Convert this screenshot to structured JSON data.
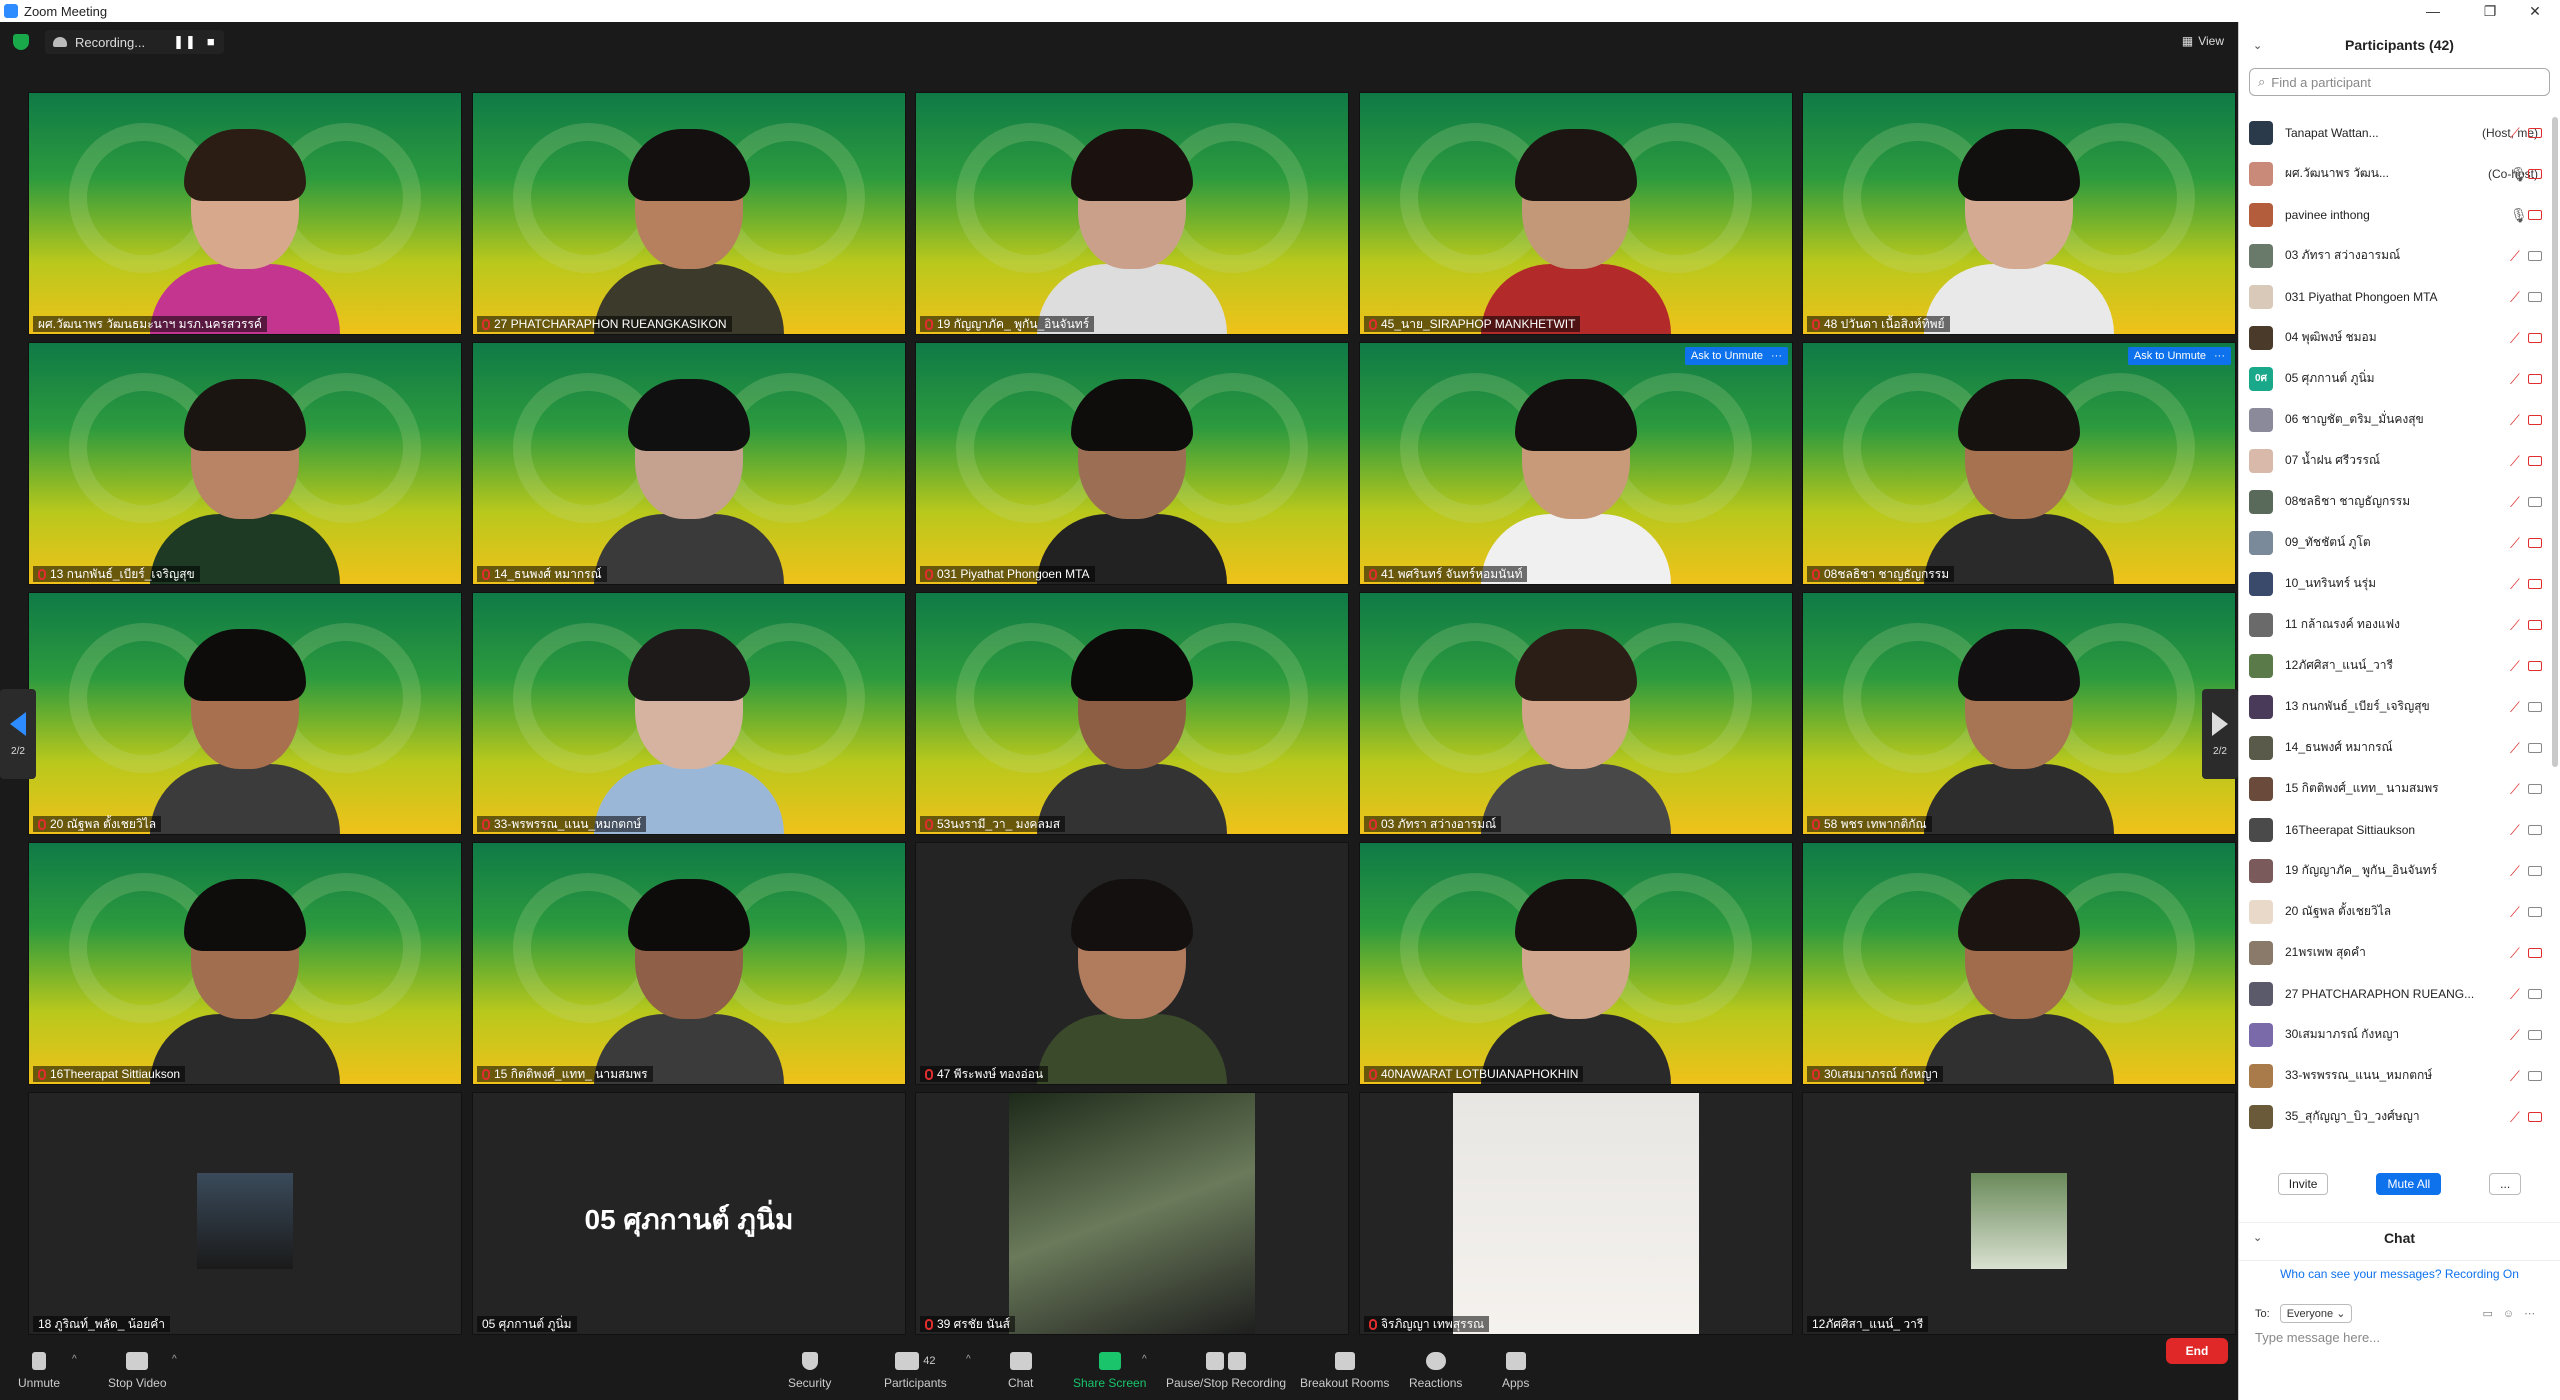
{
  "window": {
    "title": "Zoom Meeting"
  },
  "recording": {
    "label": "Recording...",
    "pause_glyph": "❚❚",
    "stop_glyph": "■"
  },
  "view_button": {
    "label": "View"
  },
  "tiles": [
    {
      "name": "ผศ.วัฒนาพร วัฒนธมะนาฯ มรภ.นครสวรรค์",
      "bg": "green",
      "muted": false,
      "skin": "#d7a88b",
      "hair": "#2b1c14",
      "shirt": "#c4358f"
    },
    {
      "name": "27 PHATCHARAPHON RUEANGKASIKON",
      "bg": "green",
      "muted": true,
      "skin": "#b6805f",
      "hair": "#141010",
      "shirt": "#3c3a2a"
    },
    {
      "name": "19 กัญญาภัค_ พูกัน_อินจันทร์",
      "bg": "green",
      "muted": true,
      "skin": "#caa08b",
      "hair": "#1b1210",
      "shirt": "#ddd"
    },
    {
      "name": "45_นาย_SIRAPHOP MANKHETWIT",
      "bg": "green",
      "muted": true,
      "skin": "#c29878",
      "hair": "#1c1512",
      "shirt": "#b22a2a"
    },
    {
      "name": "48 ปวันดา เนื้อสิงห์ทิพย์",
      "bg": "green",
      "muted": true,
      "skin": "#d4aa92",
      "hair": "#12100e",
      "shirt": "#e9e9e9"
    },
    {
      "name": "13 กนกพันธ์_เบียร์_เจริญสุข",
      "bg": "green",
      "muted": true,
      "skin": "#b98465",
      "hair": "#1b1512",
      "shirt": "#1e3a24"
    },
    {
      "name": "14_ธนพงศ์ หมากรณ์",
      "bg": "green",
      "muted": true,
      "skin": "#c5a18f",
      "hair": "#101010",
      "shirt": "#3a3a3a"
    },
    {
      "name": "031 Piyathat Phongoen MTA",
      "bg": "green",
      "muted": true,
      "skin": "#9c6f55",
      "hair": "#0f0d0c",
      "shirt": "#222"
    },
    {
      "name": "41 พศรินทร์ จันทร์หอมนันท์",
      "bg": "green",
      "muted": true,
      "skin": "#c89a7a",
      "hair": "#141010",
      "shirt": "#f0f0f0",
      "ask": true
    },
    {
      "name": "08ชลธิชา ชาญธัญกรรม",
      "bg": "green",
      "muted": true,
      "skin": "#a7724f",
      "hair": "#161210",
      "shirt": "#2a2a2a",
      "ask": true
    },
    {
      "name": "20 ณัฐพล ตั้งเชยวิไล",
      "bg": "green",
      "muted": true,
      "skin": "#a8704f",
      "hair": "#0e0c0b",
      "shirt": "#3b3b3b"
    },
    {
      "name": "33-พรพรรณ_แนน_หมกตกษ์",
      "bg": "green",
      "muted": true,
      "skin": "#d6b3a1",
      "hair": "#1d1a19",
      "shirt": "#9bb7d8"
    },
    {
      "name": "53นงรามี_วา_ มงคลมส",
      "bg": "green",
      "muted": true,
      "skin": "#8e5e44",
      "hair": "#0d0b0a",
      "shirt": "#333"
    },
    {
      "name": "03 ภัทรา สว่างอารมณ์",
      "bg": "green",
      "muted": true,
      "skin": "#d2a58a",
      "hair": "#2b1e17",
      "shirt": "#484848"
    },
    {
      "name": "58 พชร เทพากติกัณ",
      "bg": "green",
      "muted": true,
      "skin": "#a77553",
      "hair": "#121010",
      "shirt": "#2d2d2d"
    },
    {
      "name": "16Theerapat Sittiaukson",
      "bg": "green",
      "muted": true,
      "skin": "#a26e50",
      "hair": "#0f0d0c",
      "shirt": "#2b2b2b"
    },
    {
      "name": "15 กิตติพงศ์_แทท_ นามสมพร",
      "bg": "green",
      "muted": true,
      "skin": "#8f6047",
      "hair": "#0e0c0b",
      "shirt": "#3b3b3b"
    },
    {
      "name": "47 พีระพงษ์ ทองอ่อน",
      "bg": "dark",
      "muted": true,
      "skin": "#b07c5d",
      "hair": "#141010",
      "shirt": "#3c4a2c"
    },
    {
      "name": "40NAWARAT LOTBUIANAPHOKHIN",
      "bg": "green",
      "muted": true,
      "skin": "#d1a78d",
      "hair": "#16110f",
      "shirt": "#2a2a2a"
    },
    {
      "name": "30เสมมาภรณ์ กังหญา",
      "bg": "green",
      "muted": true,
      "skin": "#a06c4c",
      "hair": "#1b1410",
      "shirt": "#303030"
    },
    {
      "name": "18 ภูริณท์_พลัด_ น้อยคำ",
      "bg": "dark",
      "muted": false,
      "thumb": "photo"
    },
    {
      "name": "05 ศุภกานต์ ภูนิ่ม",
      "bg": "dark",
      "muted": false,
      "big": "05 ศุภกานต์ ภูนิ่ม"
    },
    {
      "name": "39 ศรชัย นันส์",
      "bg": "dark",
      "muted": true,
      "thumb": "video-tall"
    },
    {
      "name": "จิรภิญญา เทพสุรรณ",
      "bg": "dark",
      "muted": true,
      "thumb": "video-sweet"
    },
    {
      "name": "12ภัศศิสา_แนน์_ วารี",
      "bg": "dark",
      "muted": false,
      "thumb": "photo-small"
    }
  ],
  "page_indicator": "2/2",
  "toolbar": {
    "unmute": "Unmute",
    "stop_video": "Stop Video",
    "security": "Security",
    "participants": "Participants",
    "participants_count": "42",
    "chat": "Chat",
    "share_screen": "Share Screen",
    "pause_stop_recording": "Pause/Stop Recording",
    "breakout_rooms": "Breakout Rooms",
    "reactions": "Reactions",
    "apps": "Apps",
    "end": "End"
  },
  "panel": {
    "title": "Participants (42)",
    "search_placeholder": "Find a participant",
    "participants": [
      {
        "name": "Tanapat Wattan...",
        "role": "(Host, me)",
        "mic": "off",
        "cam": "off",
        "avatar": "#2a3a4a"
      },
      {
        "name": "ผศ.วัฒนาพร วัฒน...",
        "role": "(Co-host)",
        "mic": "on",
        "cam": "off",
        "avatar": "#c98a7a"
      },
      {
        "name": "pavinee inthong",
        "role": "",
        "mic": "on",
        "cam": "off",
        "avatar": "#b35d3d"
      },
      {
        "name": "03 ภัทรา สว่างอารมณ์",
        "role": "",
        "mic": "off",
        "cam": "on",
        "avatar": "#6a7a6a"
      },
      {
        "name": "031 Piyathat Phongoen MTA",
        "role": "",
        "mic": "off",
        "cam": "on",
        "avatar": "#d9c9b9"
      },
      {
        "name": "04 พุฒิพงษ์ ชมอม",
        "role": "",
        "mic": "off",
        "cam": "off",
        "avatar": "#4a3a2a"
      },
      {
        "name": "05 ศุภกานต์ ภูนิ่ม",
        "role": "",
        "mic": "off",
        "cam": "off",
        "avatar": "#1aa88a",
        "initials": "0ศ"
      },
      {
        "name": "06 ชาญชัต_ตริม_มั่นคงสุข",
        "role": "",
        "mic": "off",
        "cam": "off",
        "avatar": "#8a8a9a"
      },
      {
        "name": "07 น้ำฝน ศรีวรรณ์",
        "role": "",
        "mic": "off",
        "cam": "off",
        "avatar": "#d9b9a9"
      },
      {
        "name": "08ชลธิชา ชาญธัญกรรม",
        "role": "",
        "mic": "off",
        "cam": "on",
        "avatar": "#5a6a5a"
      },
      {
        "name": "09_ทัชชัตน์ ภูโต",
        "role": "",
        "mic": "off",
        "cam": "off",
        "avatar": "#7a8a9a"
      },
      {
        "name": "10_นทรินทร์ นรุ่ม",
        "role": "",
        "mic": "off",
        "cam": "off",
        "avatar": "#3a4a6a"
      },
      {
        "name": "11 กล้าณรงค์ ทองแฟง",
        "role": "",
        "mic": "off",
        "cam": "off",
        "avatar": "#6a6a6a"
      },
      {
        "name": "12ภัศศิสา_แนน์_วารี",
        "role": "",
        "mic": "off",
        "cam": "off",
        "avatar": "#5a7a4a"
      },
      {
        "name": "13 กนกพันธ์_เบียร์_เจริญสุข",
        "role": "",
        "mic": "off",
        "cam": "on",
        "avatar": "#4a3a5a"
      },
      {
        "name": "14_ธนพงศ์ หมากรณ์",
        "role": "",
        "mic": "off",
        "cam": "on",
        "avatar": "#5a5a4a"
      },
      {
        "name": "15 กิตติพงศ์_แทท_ นามสมพร",
        "role": "",
        "mic": "off",
        "cam": "on",
        "avatar": "#6a4a3a"
      },
      {
        "name": "16Theerapat Sittiaukson",
        "role": "",
        "mic": "off",
        "cam": "on",
        "avatar": "#4a4a4a"
      },
      {
        "name": "19 กัญญาภัค_ พูกัน_อินจันทร์",
        "role": "",
        "mic": "off",
        "cam": "on",
        "avatar": "#7a5a5a"
      },
      {
        "name": "20 ณัฐพล ตั้งเชยวิไล",
        "role": "",
        "mic": "off",
        "cam": "on",
        "avatar": "#e9d9c9"
      },
      {
        "name": "21พรเพพ สุดคำ",
        "role": "",
        "mic": "off",
        "cam": "off",
        "avatar": "#8a7a6a"
      },
      {
        "name": "27 PHATCHARAPHON RUEANG...",
        "role": "",
        "mic": "off",
        "cam": "on",
        "avatar": "#5a5a6a"
      },
      {
        "name": "30เสมมาภรณ์ กังหญา",
        "role": "",
        "mic": "off",
        "cam": "on",
        "avatar": "#7a6aa9"
      },
      {
        "name": "33-พรพรรณ_แนน_หมกตกษ์",
        "role": "",
        "mic": "off",
        "cam": "on",
        "avatar": "#a97a4a"
      },
      {
        "name": "35_สุกัญญา_บิว_วงศ์ษญา",
        "role": "",
        "mic": "off",
        "cam": "off",
        "avatar": "#6a5a3a"
      }
    ],
    "invite": "Invite",
    "mute_all": "Mute All",
    "more": "..."
  },
  "chat": {
    "title": "Chat",
    "who_can_see": "Who can see your messages? Recording On",
    "to_label": "To:",
    "to_value": "Everyone",
    "placeholder": "Type message here..."
  },
  "colors": {
    "accent": "#0e72ed",
    "muted_red": "#e02d2d",
    "end_red": "#e02828",
    "share_green": "#19c46b"
  }
}
